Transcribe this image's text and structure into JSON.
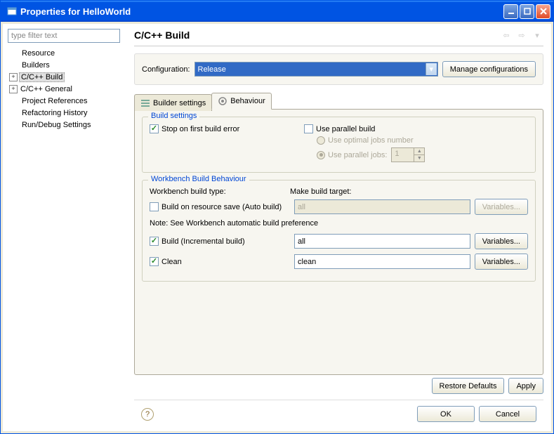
{
  "window": {
    "title": "Properties for HelloWorld"
  },
  "sidebar": {
    "filter_placeholder": "type filter text",
    "items": [
      {
        "label": "Resource",
        "expandable": false
      },
      {
        "label": "Builders",
        "expandable": false
      },
      {
        "label": "C/C++ Build",
        "expandable": true,
        "selected": true
      },
      {
        "label": "C/C++ General",
        "expandable": true
      },
      {
        "label": "Project References",
        "expandable": false
      },
      {
        "label": "Refactoring History",
        "expandable": false
      },
      {
        "label": "Run/Debug Settings",
        "expandable": false
      }
    ]
  },
  "page": {
    "title": "C/C++ Build"
  },
  "config": {
    "label": "Configuration:",
    "value": "Release",
    "manage_btn": "Manage configurations"
  },
  "tabs": {
    "builder": "Builder settings",
    "behaviour": "Behaviour"
  },
  "build_settings": {
    "group_title": "Build settings",
    "stop_on_error": "Stop on first build error",
    "use_parallel": "Use parallel build",
    "optimal_jobs": "Use optimal jobs number",
    "parallel_jobs": "Use parallel jobs:",
    "parallel_jobs_value": "1"
  },
  "workbench": {
    "group_title": "Workbench Build Behaviour",
    "build_type_label": "Workbench build type:",
    "target_label": "Make build target:",
    "auto_build": "Build on resource save (Auto build)",
    "auto_build_target": "all",
    "note": "Note: See Workbench automatic build preference",
    "incremental": "Build (Incremental build)",
    "incremental_target": "all",
    "clean": "Clean",
    "clean_target": "clean",
    "variables_btn": "Variables..."
  },
  "footer": {
    "restore": "Restore Defaults",
    "apply": "Apply",
    "ok": "OK",
    "cancel": "Cancel"
  }
}
